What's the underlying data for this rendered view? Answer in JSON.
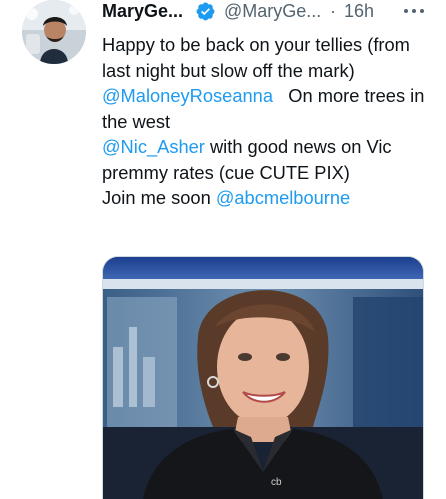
{
  "tweet": {
    "author": {
      "display_name": "MaryGe...",
      "handle": "@MaryGe...",
      "verified": true,
      "avatar_icon": "user-avatar-photo"
    },
    "separator": "·",
    "timestamp": "16h",
    "more_icon": "more-horizontal-icon",
    "body": {
      "line1": "Happy to be back on your tellies (from last night but slow off the mark)",
      "mention1": "@MaloneyRoseanna",
      "after_mention1": "   On more trees in the west",
      "mention2": "@Nic_Asher",
      "after_mention2": " with good news on Vic premmy rates (cue CUTE PIX)",
      "before_mention3": "Join me soon ",
      "mention3": "@abcmelbourne"
    },
    "media": {
      "watermark": "cb"
    }
  },
  "colors": {
    "link": "#1d9bf0",
    "verified": "#1d9bf0",
    "text": "#0f1419",
    "secondary": "#536471"
  }
}
